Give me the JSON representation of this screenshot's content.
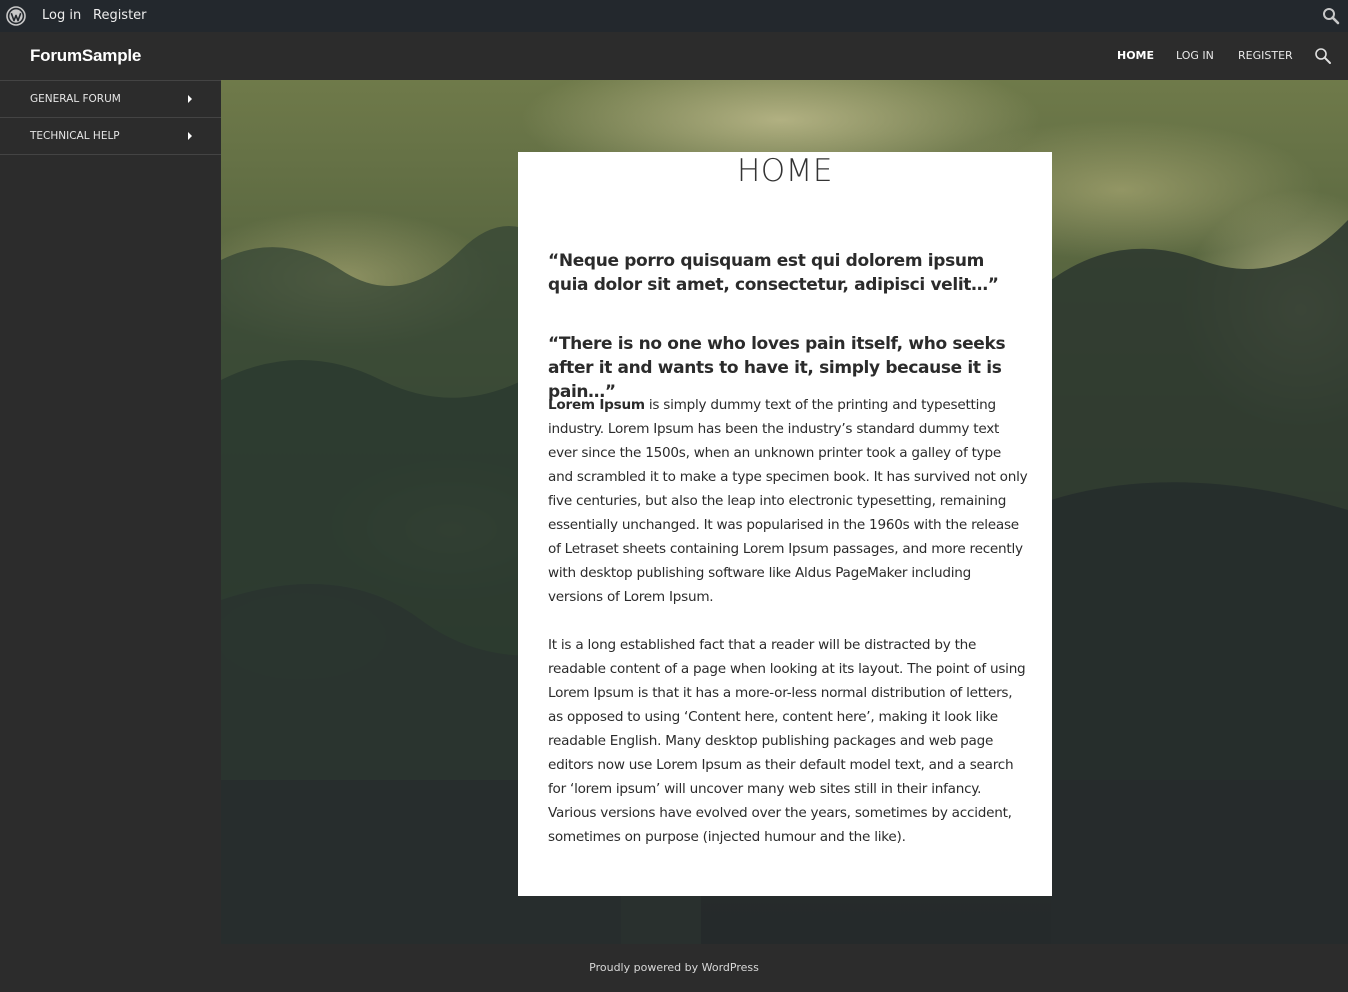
{
  "adminbar": {
    "login": "Log in",
    "register": "Register",
    "logo_icon": "wordpress-icon",
    "search_icon": "search-icon"
  },
  "header": {
    "site_title": "ForumSample",
    "nav": [
      {
        "label": "HOME",
        "active": true
      },
      {
        "label": "LOG IN",
        "active": false
      },
      {
        "label": "REGISTER",
        "active": false
      }
    ],
    "search_icon": "search-icon"
  },
  "sidebar": {
    "items": [
      {
        "label": "GENERAL FORUM",
        "icon": "chevron-right-icon"
      },
      {
        "label": "TECHNICAL HELP",
        "icon": "chevron-right-icon"
      }
    ]
  },
  "content": {
    "title": "HOME",
    "quote1": "“Neque porro quisquam est qui dolorem ipsum quia dolor sit amet, consectetur, adipisci velit…”",
    "quote2": "“There is no one who loves pain itself, who seeks after it and wants to have it, simply because it is pain…”",
    "para1_bold": "Lorem Ipsum",
    "para1_rest": " is simply dummy text of the printing and typesetting industry. Lorem Ipsum has been the industry’s standard dummy text ever since the 1500s, when an unknown printer took a galley of type and scrambled it to make a type specimen book. It has survived not only five centuries, but also the leap into electronic typesetting, remaining essentially unchanged. It was popularised in the 1960s with the release of Letraset sheets containing Lorem Ipsum passages, and more recently with desktop publishing software like Aldus PageMaker including versions of Lorem Ipsum.",
    "para2": "It is a long established fact that a reader will be distracted by the readable content of a page when looking at its layout. The point of using Lorem Ipsum is that it has a more-or-less normal distribution of letters, as opposed to using ‘Content here, content here’, making it look like readable English. Many desktop publishing packages and web page editors now use Lorem Ipsum as their default model text, and a search for ‘lorem ipsum’ will uncover many web sites still in their infancy. Various versions have evolved over the years, sometimes by accident, sometimes on purpose (injected humour and the like)."
  },
  "footer": {
    "credit": "Proudly powered by WordPress"
  },
  "colors": {
    "adminbar_bg": "#23282d",
    "header_bg": "#2c2c2c",
    "card_bg": "#ffffff",
    "text": "#2b2b2b"
  }
}
